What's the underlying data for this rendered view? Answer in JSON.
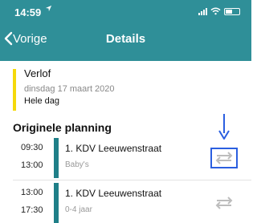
{
  "status_bar": {
    "time": "14:59"
  },
  "nav": {
    "back_label": "Vorige",
    "title": "Details"
  },
  "leave": {
    "title": "Verlof",
    "date": "dinsdag 17 maart 2020",
    "duration": "Hele dag"
  },
  "section_title": "Originele planning",
  "shifts": [
    {
      "start": "09:30",
      "end": "13:00",
      "location": "1. KDV Leeuwenstraat",
      "group": "Baby's"
    },
    {
      "start": "13:00",
      "end": "17:30",
      "location": "1. KDV Leeuwenstraat",
      "group": "0-4 jaar"
    }
  ],
  "icons": {
    "location_arrow": "location-arrow-icon",
    "signal": "signal-icon",
    "wifi": "wifi-icon",
    "battery": "battery-icon",
    "back": "chevron-left-icon",
    "swap": "swap-icon",
    "pointer": "arrow-down-icon"
  },
  "colors": {
    "header": "#2f8f98",
    "leave_bar": "#f5d90a",
    "shift_bar": "#1f7f88",
    "highlight": "#2b5fe0",
    "swap_icon": "#bdbdbd"
  }
}
